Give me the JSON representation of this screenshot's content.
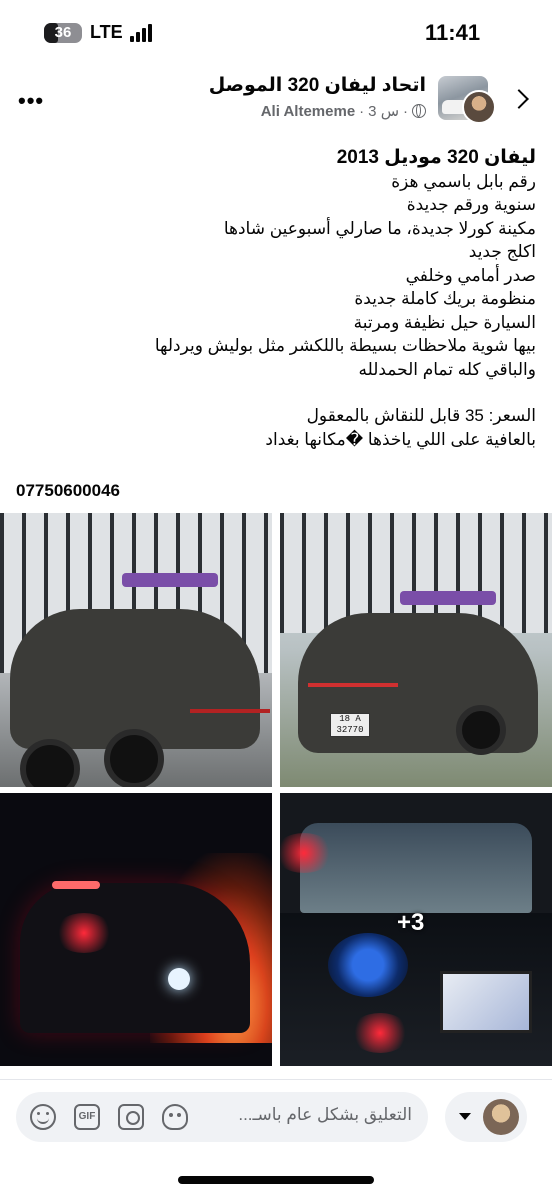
{
  "status_bar": {
    "battery": "36",
    "network": "LTE",
    "time": "11:41"
  },
  "post": {
    "group_name": "اتحاد ليفان 320 الموصل",
    "author": "Ali Altememe",
    "age": "3 س",
    "lines": [
      "ليفان 320 موديل 2013",
      "رقم بابل باسمي هزة",
      "سنوية ورقم جديدة",
      "مكينة كورلا جديدة، ما صارلي أسبوعين شادها",
      "اكلج جديد",
      "صدر أمامي وخلفي",
      "منظومة بريك كاملة جديدة",
      "السيارة حيل نظيفة ومرتبة",
      "بيها شوية ملاحظات بسيطة باللكشر مثل بوليش ويردلها",
      "والباقي كله تمام الحمدلله"
    ],
    "price_lines": [
      "السعر: 35 قابل للنقاش بالمعقول",
      "بالعافية على اللي ياخذها �مكانها بغداد"
    ],
    "phone": "07750600046",
    "photos": {
      "plate_text_1": "18 A",
      "plate_text_2": "32770",
      "more_count": "+3"
    }
  },
  "comment_bar": {
    "placeholder": "التعليق بشكل عام باسـ..."
  },
  "icons": {
    "more": "more-dots-icon",
    "chevron": "chevron-right-icon",
    "emoji": "smile-icon",
    "gif": "GIF",
    "camera": "camera-icon",
    "avatar": "avatar-sticker-icon"
  }
}
